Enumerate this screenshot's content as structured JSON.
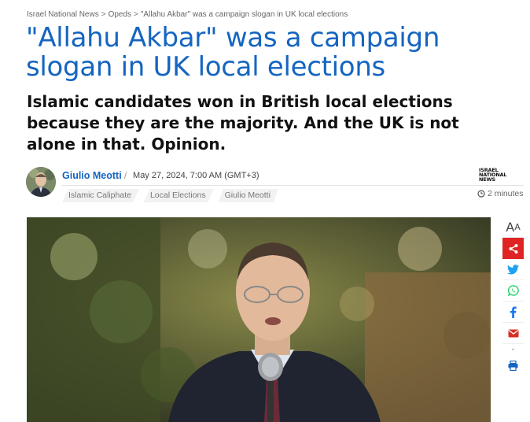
{
  "breadcrumb": {
    "items": [
      "Israel National News",
      "Opeds",
      "\"Allahu Akbar\" was a campaign slogan in UK local elections"
    ],
    "separator": ">"
  },
  "article": {
    "title": "\"Allahu Akbar\" was a campaign slogan in UK local elections",
    "subtitle": "Islamic candidates won in British local elections because they are the majority. And the UK is not alone in that. Opinion.",
    "author": "Giulio Meotti",
    "author_separator": "/",
    "date": "May 27, 2024, 7:00 AM (GMT+3)",
    "tags": [
      "Islamic Caliphate",
      "Local Elections",
      "Giulio Meotti"
    ],
    "read_time": "2 minutes",
    "publisher_logo_text": [
      "ISRAEL",
      "NATIONAL",
      "NEWS"
    ]
  },
  "share_bar": {
    "font_size_label_large": "A",
    "font_size_label_small": "A",
    "buttons": [
      "share-icon",
      "twitter-icon",
      "whatsapp-icon",
      "facebook-icon",
      "email-icon",
      "print-icon"
    ]
  },
  "colors": {
    "title_blue": "#1565c0",
    "share_red": "#e02424",
    "twitter_blue": "#1da1f2",
    "whatsapp_green": "#25d366",
    "facebook_blue": "#1877f2",
    "email_red": "#d93025",
    "print_blue": "#1565c0"
  }
}
